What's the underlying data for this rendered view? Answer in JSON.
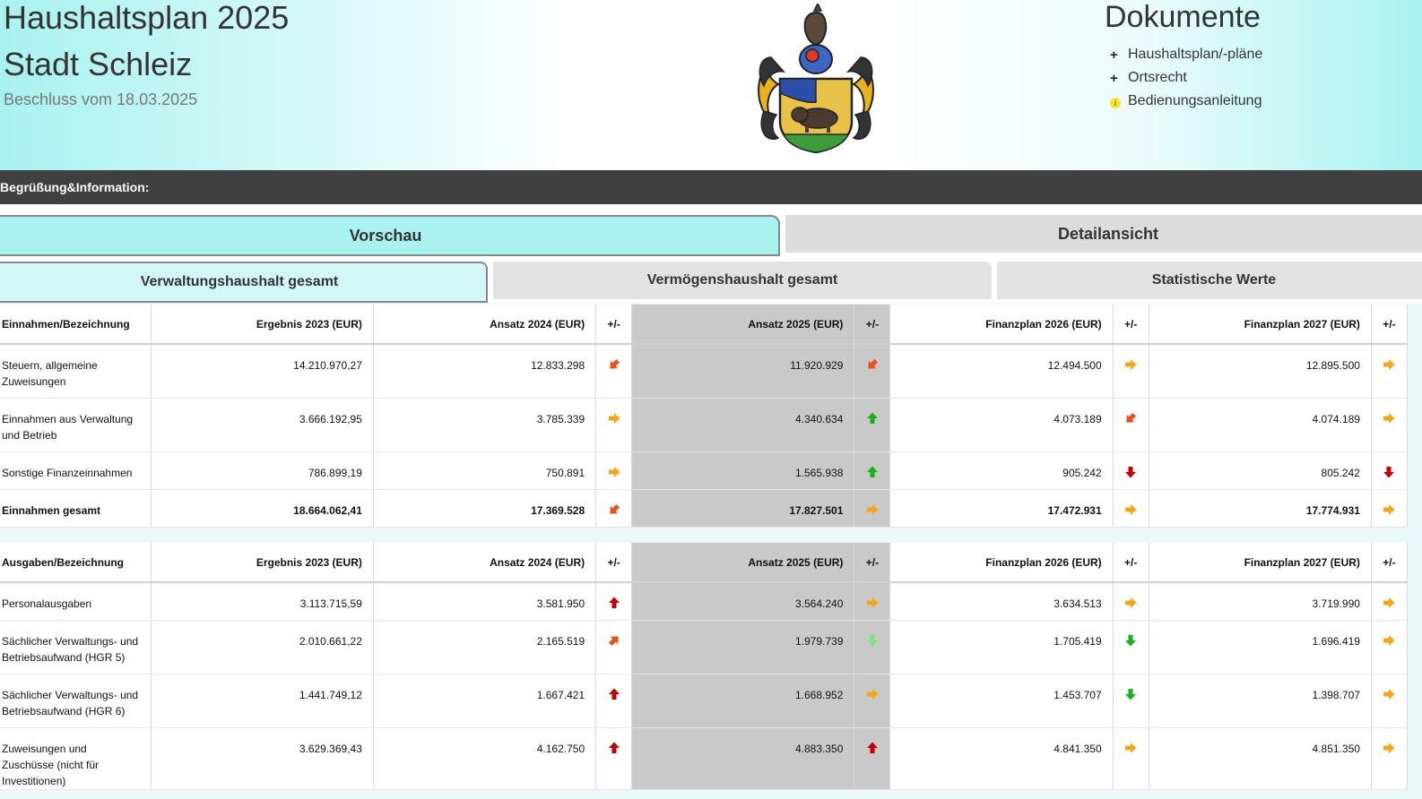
{
  "header": {
    "title": "Haushaltsplan 2025",
    "city": "Stadt Schleiz",
    "decision": "Beschluss vom 18.03.2025",
    "docs_title": "Dokumente",
    "docs": [
      {
        "mark": "+",
        "label": "Haushaltsplan/-pläne"
      },
      {
        "mark": "+",
        "label": "Ortsrecht"
      },
      {
        "mark": "i",
        "label": "Bedienungsanleitung"
      }
    ]
  },
  "infobar": {
    "label": "Begrüßung&Information:"
  },
  "tabs": {
    "preview": "Vorschau",
    "detail": "Detailansicht"
  },
  "subtabs": {
    "admin": "Verwaltungshaushalt gesamt",
    "assets": "Vermögenshaushalt gesamt",
    "stats": "Statistische Werte"
  },
  "income": {
    "headers": [
      "Einnahmen/Bezeichnung",
      "Ergebnis 2023 (EUR)",
      "Ansatz 2024 (EUR)",
      "+/-",
      "Ansatz 2025 (EUR)",
      "+/-",
      "Finanzplan 2026 (EUR)",
      "+/-",
      "Finanzplan 2027 (EUR)",
      "+/-"
    ],
    "rows": [
      {
        "label": "Steuern, allgemeine Zuweisungen",
        "v2023": "14.210.970,27",
        "v2024": "12.833.298",
        "a2024": "down-left",
        "v2025": "11.920.929",
        "a2025": "down-left",
        "v2026": "12.494.500",
        "a2026": "right",
        "v2027": "12.895.500",
        "a2027": "right"
      },
      {
        "label": "Einnahmen aus Verwaltung und Betrieb",
        "v2023": "3.666.192,95",
        "v2024": "3.785.339",
        "a2024": "right",
        "v2025": "4.340.634",
        "a2025": "up-green",
        "v2026": "4.073.189",
        "a2026": "down-left",
        "v2027": "4.074.189",
        "a2027": "right"
      },
      {
        "label": "Sonstige Finanzeinnahmen",
        "v2023": "786.899,19",
        "v2024": "750.891",
        "a2024": "right",
        "v2025": "1.565.938",
        "a2025": "up-green",
        "v2026": "905.242",
        "a2026": "down-red",
        "v2027": "805.242",
        "a2027": "down-red"
      },
      {
        "label": "Einnahmen gesamt",
        "v2023": "18.664.062,41",
        "v2024": "17.369.528",
        "a2024": "down-left",
        "v2025": "17.827.501",
        "a2025": "right",
        "v2026": "17.472.931",
        "a2026": "right",
        "v2027": "17.774.931",
        "a2027": "right",
        "total": true
      }
    ]
  },
  "expenses": {
    "headers": [
      "Ausgaben/Bezeichnung",
      "Ergebnis 2023 (EUR)",
      "Ansatz 2024 (EUR)",
      "+/-",
      "Ansatz 2025 (EUR)",
      "+/-",
      "Finanzplan 2026 (EUR)",
      "+/-",
      "Finanzplan 2027 (EUR)",
      "+/-"
    ],
    "rows": [
      {
        "label": "Personalausgaben",
        "v2023": "3.113.715,59",
        "v2024": "3.581.950",
        "a2024": "up-red",
        "v2025": "3.564.240",
        "a2025": "right",
        "v2026": "3.634.513",
        "a2026": "right",
        "v2027": "3.719.990",
        "a2027": "right"
      },
      {
        "label": "Sächlicher Verwaltungs- und Betriebsaufwand (HGR 5)",
        "v2023": "2.010.661,22",
        "v2024": "2.165.519",
        "a2024": "up-right",
        "v2025": "1.979.739",
        "a2025": "down-lightgreen",
        "v2026": "1.705.419",
        "a2026": "down-green",
        "v2027": "1.696.419",
        "a2027": "right"
      },
      {
        "label": "Sächlicher Verwaltungs- und Betriebsaufwand (HGR 6)",
        "v2023": "1.441.749,12",
        "v2024": "1.667.421",
        "a2024": "up-red",
        "v2025": "1.668.952",
        "a2025": "right",
        "v2026": "1.453.707",
        "a2026": "down-green",
        "v2027": "1.398.707",
        "a2027": "right"
      },
      {
        "label": "Zuweisungen und Zuschüsse (nicht für Investitionen)",
        "v2023": "3.629.369,43",
        "v2024": "4.162.750",
        "a2024": "up-red",
        "v2025": "4.883.350",
        "a2025": "up-red",
        "v2026": "4.841.350",
        "a2026": "right",
        "v2027": "4.851.350",
        "a2027": "right"
      }
    ]
  },
  "colors": {
    "accent": "#a9f2f0",
    "bar": "#404040",
    "highlight": "#c9c9c9",
    "orange": "#f5a614",
    "redorange": "#e8501c",
    "green": "#16b316",
    "lightgreen": "#7be37b",
    "red": "#c40000"
  },
  "icons": {
    "down-left": "arrow-down-left-icon",
    "up-right": "arrow-up-right-icon",
    "right": "arrow-right-icon",
    "up-green": "arrow-up-icon",
    "up-red": "arrow-up-icon",
    "down-red": "arrow-down-icon",
    "down-green": "arrow-down-icon",
    "down-lightgreen": "arrow-down-icon"
  }
}
